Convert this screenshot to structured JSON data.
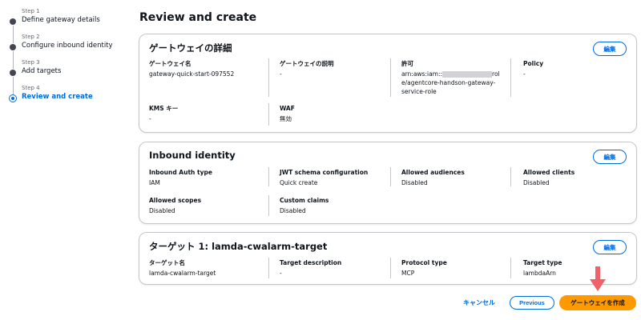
{
  "steps": [
    {
      "num": "Step 1",
      "title": "Define gateway details"
    },
    {
      "num": "Step 2",
      "title": "Configure inbound identity"
    },
    {
      "num": "Step 3",
      "title": "Add targets"
    },
    {
      "num": "Step 4",
      "title": "Review and create"
    }
  ],
  "page_title": "Review and create",
  "edit_label": "編集",
  "gateway_details": {
    "title": "ゲートウェイの詳細",
    "name_label": "ゲートウェイ名",
    "name_value": "gateway-quick-start-097552",
    "desc_label": "ゲートウェイの説明",
    "desc_value": "-",
    "perm_label": "許可",
    "perm_prefix": "arn:aws:iam::",
    "perm_suffix": "rol",
    "perm_rest": "e/agentcore-handson-gateway-service-role",
    "policy_label": "Policy",
    "policy_value": "-",
    "kms_label": "KMS キー",
    "kms_value": "-",
    "waf_label": "WAF",
    "waf_value": "無効"
  },
  "inbound": {
    "title": "Inbound identity",
    "auth_label": "Inbound Auth type",
    "auth_value": "IAM",
    "jwt_label": "JWT schema configuration",
    "jwt_value": "Quick create",
    "aud_label": "Allowed audiences",
    "aud_value": "Disabled",
    "clients_label": "Allowed clients",
    "clients_value": "Disabled",
    "scopes_label": "Allowed scopes",
    "scopes_value": "Disabled",
    "claims_label": "Custom claims",
    "claims_value": "Disabled"
  },
  "target": {
    "title": "ターゲット 1: lamda-cwalarm-target",
    "name_label": "ターゲット名",
    "name_value": "lamda-cwalarm-target",
    "desc_label": "Target description",
    "desc_value": "-",
    "protocol_label": "Protocol type",
    "protocol_value": "MCP",
    "type_label": "Target type",
    "type_value": "lambdaArn"
  },
  "footer": {
    "cancel": "キャンセル",
    "previous": "Previous",
    "create": "ゲートウェイを作成"
  },
  "colors": {
    "accent": "#006ce0",
    "primary_button": "#ff9900",
    "arrow": "#f0616a"
  }
}
